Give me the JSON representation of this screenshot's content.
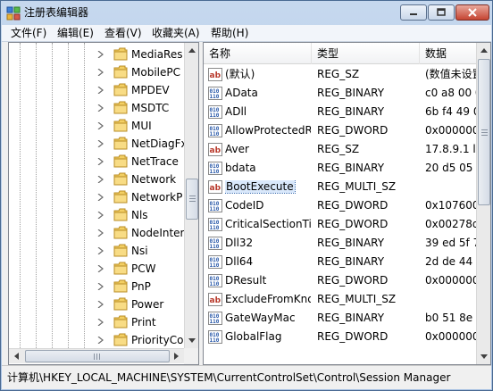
{
  "window": {
    "title": "注册表编辑器",
    "title_icon": "regedit-icon",
    "controls": [
      "minimize-icon",
      "maximize-icon",
      "close-icon"
    ]
  },
  "menu": [
    "文件(F)",
    "编辑(E)",
    "查看(V)",
    "收藏夹(A)",
    "帮助(H)"
  ],
  "tree": {
    "items": [
      {
        "label": "MediaRes"
      },
      {
        "label": "MobilePC"
      },
      {
        "label": "MPDEV"
      },
      {
        "label": "MSDTC"
      },
      {
        "label": "MUI"
      },
      {
        "label": "NetDiagFx"
      },
      {
        "label": "NetTrace"
      },
      {
        "label": "Network"
      },
      {
        "label": "NetworkP"
      },
      {
        "label": "Nls"
      },
      {
        "label": "NodeInter"
      },
      {
        "label": "Nsi"
      },
      {
        "label": "PCW"
      },
      {
        "label": "PnP"
      },
      {
        "label": "Power"
      },
      {
        "label": "Print"
      },
      {
        "label": "PriorityCo"
      }
    ]
  },
  "list": {
    "columns": {
      "name": "名称",
      "type": "类型",
      "data": "数据"
    },
    "rows": [
      {
        "icon": "string-value-icon",
        "name": "(默认)",
        "type": "REG_SZ",
        "data": "(数值未设置)"
      },
      {
        "icon": "binary-value-icon",
        "name": "AData",
        "type": "REG_BINARY",
        "data": "c0 a8 00 0"
      },
      {
        "icon": "binary-value-icon",
        "name": "ADll",
        "type": "REG_BINARY",
        "data": "6b f4 49 0"
      },
      {
        "icon": "binary-value-icon",
        "name": "AllowProtectedRenames",
        "type": "REG_DWORD",
        "data": "0x000000"
      },
      {
        "icon": "string-value-icon",
        "name": "Aver",
        "type": "REG_SZ",
        "data": "17.8.9.1 li"
      },
      {
        "icon": "binary-value-icon",
        "name": "bdata",
        "type": "REG_BINARY",
        "data": "20 d5 05"
      },
      {
        "icon": "multi-string-value-icon",
        "name": "BootExecute",
        "type": "REG_MULTI_SZ",
        "data": ""
      },
      {
        "icon": "binary-value-icon",
        "name": "CodeID",
        "type": "REG_DWORD",
        "data": "0x107600"
      },
      {
        "icon": "binary-value-icon",
        "name": "CriticalSectionTimeout",
        "type": "REG_DWORD",
        "data": "0x00278d"
      },
      {
        "icon": "binary-value-icon",
        "name": "Dll32",
        "type": "REG_BINARY",
        "data": "39 ed 5f 7"
      },
      {
        "icon": "binary-value-icon",
        "name": "Dll64",
        "type": "REG_BINARY",
        "data": "2d de 44"
      },
      {
        "icon": "binary-value-icon",
        "name": "DResult",
        "type": "REG_DWORD",
        "data": "0x000000"
      },
      {
        "icon": "multi-string-value-icon",
        "name": "ExcludeFromKnownDlls",
        "type": "REG_MULTI_SZ",
        "data": ""
      },
      {
        "icon": "binary-value-icon",
        "name": "GateWayMac",
        "type": "REG_BINARY",
        "data": "b0 51 8e"
      },
      {
        "icon": "binary-value-icon",
        "name": "GlobalFlag",
        "type": "REG_DWORD",
        "data": "0x000000"
      }
    ],
    "selected": "BootExecute"
  },
  "status": {
    "path": "计算机\\HKEY_LOCAL_MACHINE\\SYSTEM\\CurrentControlSet\\Control\\Session Manager"
  }
}
